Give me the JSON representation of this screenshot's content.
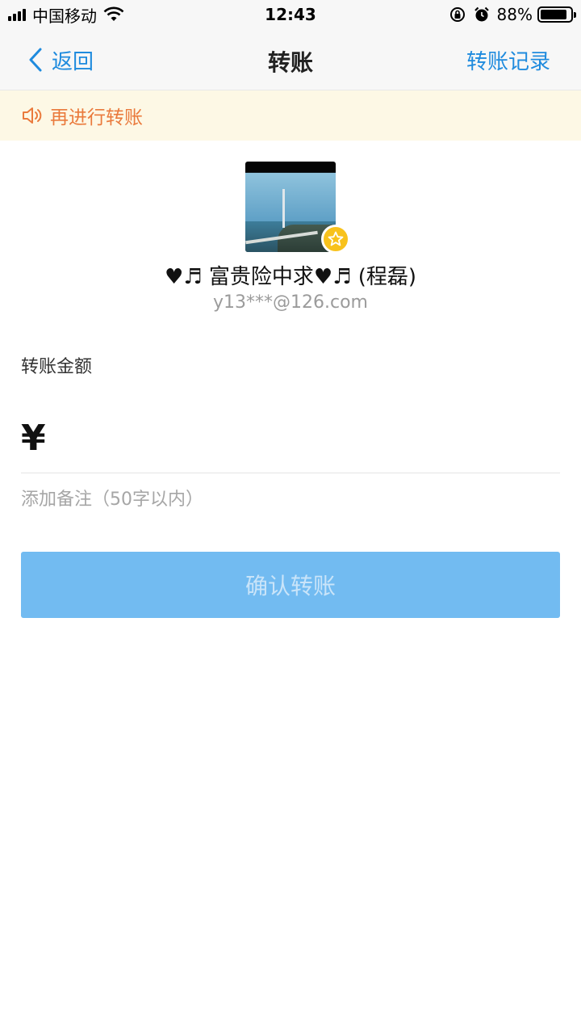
{
  "status_bar": {
    "carrier": "中国移动",
    "time": "12:43",
    "battery_percent": "88%",
    "battery_level": 0.88,
    "icons": [
      "signal-icon",
      "wifi-icon",
      "orientation-lock-icon",
      "alarm-icon",
      "battery-icon"
    ]
  },
  "nav": {
    "back_label": "返回",
    "title": "转账",
    "right_label": "转账记录"
  },
  "notice": {
    "icon": "speaker-icon",
    "text": "再进行转账"
  },
  "recipient": {
    "name": "♥♬ 富贵险中求♥♬ (程磊)",
    "account": "y13***@126.com",
    "badge_icon": "star-icon"
  },
  "amount": {
    "label": "转账金额",
    "currency": "¥",
    "value": ""
  },
  "note": {
    "placeholder": "添加备注（50字以内）"
  },
  "confirm": {
    "label": "确认转账"
  },
  "colors": {
    "accent": "#1f8bde",
    "notice_bg": "#fdf8e5",
    "notice_text": "#ea7a3c",
    "button_bg": "#72bbf1",
    "button_text": "#c9e4f9",
    "badge": "#f8c21c"
  }
}
